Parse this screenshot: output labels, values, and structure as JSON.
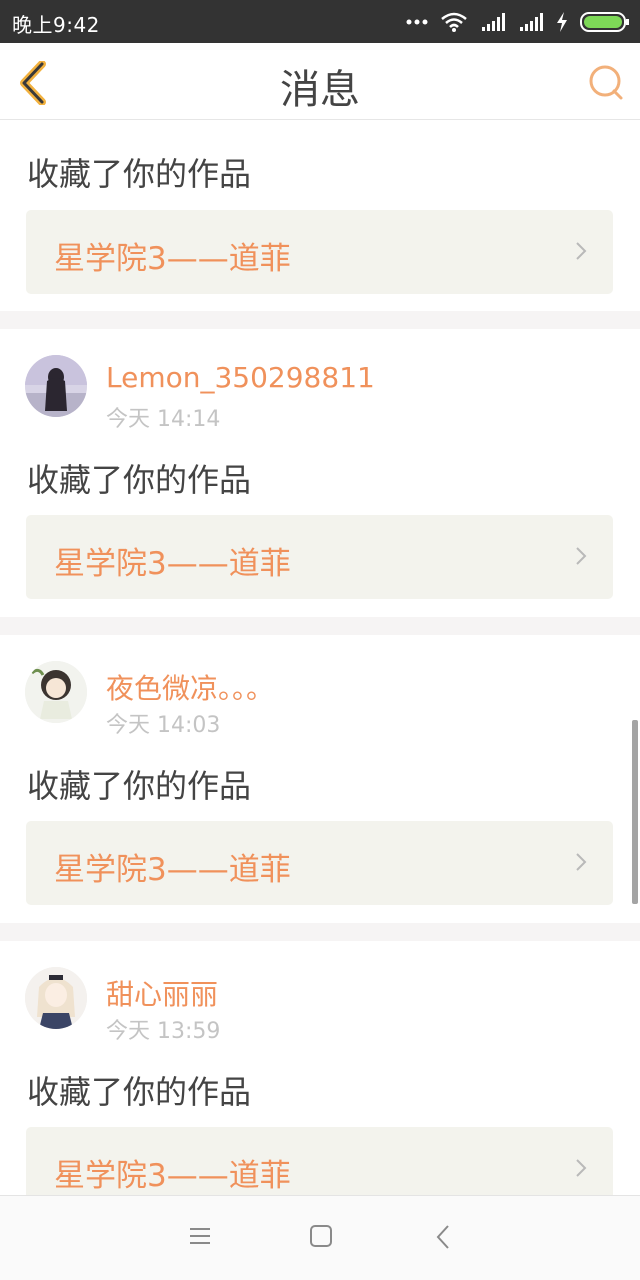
{
  "status_bar": {
    "time": "晚上9:42"
  },
  "header": {
    "title": "消息"
  },
  "notifications": [
    {
      "action": "收藏了你的作品",
      "work_title": "星学院3——道菲"
    },
    {
      "user": "Lemon_350298811",
      "time": "今天 14:14",
      "action": "收藏了你的作品",
      "work_title": "星学院3——道菲"
    },
    {
      "user": "夜色微凉。。。",
      "time": "今天 14:03",
      "action": "收藏了你的作品",
      "work_title": "星学院3——道菲"
    },
    {
      "user": "甜心丽丽",
      "time": "今天 13:59",
      "action": "收藏了你的作品",
      "work_title": "星学院3——道菲"
    }
  ],
  "colors": {
    "accent": "#f0915b",
    "status_bar": "#333333",
    "battery": "#7ed957"
  }
}
